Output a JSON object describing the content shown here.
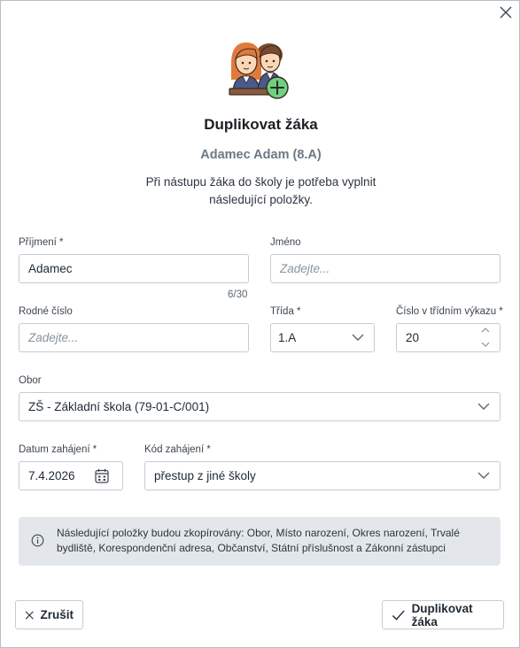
{
  "dialog": {
    "title": "Duplikovat žáka",
    "student": "Adamec Adam (8.A)",
    "description": "Při nástupu žáka do školy je potřeba vyplnit následující položky."
  },
  "form": {
    "surname": {
      "label": "Příjmení *",
      "value": "Adamec",
      "counter": "6/30"
    },
    "firstname": {
      "label": "Jméno",
      "placeholder": "Zadejte..."
    },
    "birth_number": {
      "label": "Rodné číslo",
      "placeholder": "Zadejte..."
    },
    "class": {
      "label": "Třída *",
      "value": "1.A"
    },
    "register_number": {
      "label": "Číslo v třídním výkazu *",
      "value": "20"
    },
    "field_of_study": {
      "label": "Obor",
      "value": "ZŠ - Základní škola (79-01-C/001)"
    },
    "start_date": {
      "label": "Datum zahájení *",
      "value": "7.4.2026"
    },
    "start_code": {
      "label": "Kód zahájení *",
      "value": "přestup z jiné školy"
    }
  },
  "info": {
    "text": "Následující položky budou zkopírovány: Obor, Místo narození, Okres narození, Trvalé bydliště, Korespondenční adresa, Občanství, Státní příslušnost a Zákonní zástupci"
  },
  "buttons": {
    "cancel": "Zrušit",
    "confirm": "Duplikovat žáka"
  },
  "icons": {
    "close": "close-icon",
    "calendar": "calendar-icon",
    "info": "info-icon",
    "check": "check-icon",
    "add": "plus-circle-icon"
  },
  "colors": {
    "plus_badge": "#6fd17f",
    "info_bg": "#e3e7eb",
    "subtitle": "#6b7985"
  }
}
